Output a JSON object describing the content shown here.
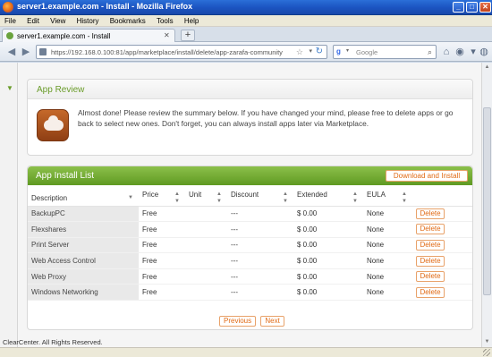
{
  "window": {
    "title": "server1.example.com - Install - Mozilla Firefox",
    "min_glyph": "_",
    "max_glyph": "□",
    "close_glyph": "✕"
  },
  "menu": [
    "File",
    "Edit",
    "View",
    "History",
    "Bookmarks",
    "Tools",
    "Help"
  ],
  "tab": {
    "label": "server1.example.com - Install",
    "close_glyph": "✕",
    "new_tab_glyph": "+"
  },
  "nav": {
    "back_glyph": "◀",
    "forward_glyph": "▶",
    "url": "https://192.168.0.100:81/app/marketplace/install/delete/app-zarafa-community",
    "star_glyph": "☆",
    "reload_glyph": "↻",
    "search_engine_glyph": "g",
    "search_placeholder": "Google",
    "search_glyph": "⌕",
    "home_glyph": "⌂"
  },
  "review": {
    "title": "App Review",
    "message": "Almost done! Please review the summary below. If you have changed your mind, please free to delete apps or go back to select new ones. Don't forget, you can always install apps later via Marketplace."
  },
  "install_list": {
    "title": "App Install List",
    "download_button": "Download and Install",
    "columns": [
      "Description",
      "Price",
      "Unit",
      "Discount",
      "Extended",
      "EULA"
    ],
    "rows": [
      {
        "description": "BackupPC",
        "price": "Free",
        "unit": "",
        "discount": "---",
        "extended": "$ 0.00",
        "eula": "None",
        "action": "Delete"
      },
      {
        "description": "Flexshares",
        "price": "Free",
        "unit": "",
        "discount": "---",
        "extended": "$ 0.00",
        "eula": "None",
        "action": "Delete"
      },
      {
        "description": "Print Server",
        "price": "Free",
        "unit": "",
        "discount": "---",
        "extended": "$ 0.00",
        "eula": "None",
        "action": "Delete"
      },
      {
        "description": "Web Access Control",
        "price": "Free",
        "unit": "",
        "discount": "---",
        "extended": "$ 0.00",
        "eula": "None",
        "action": "Delete"
      },
      {
        "description": "Web Proxy",
        "price": "Free",
        "unit": "",
        "discount": "---",
        "extended": "$ 0.00",
        "eula": "None",
        "action": "Delete"
      },
      {
        "description": "Windows Networking",
        "price": "Free",
        "unit": "",
        "discount": "---",
        "extended": "$ 0.00",
        "eula": "None",
        "action": "Delete"
      }
    ]
  },
  "pager": {
    "previous": "Previous",
    "next": "Next"
  },
  "footer": "ClearCenter. All Rights Reserved.",
  "colors": {
    "accent_green": "#6a9c2a",
    "button_orange": "#e06a14",
    "firefox_title_blue": "#1c55c2"
  }
}
